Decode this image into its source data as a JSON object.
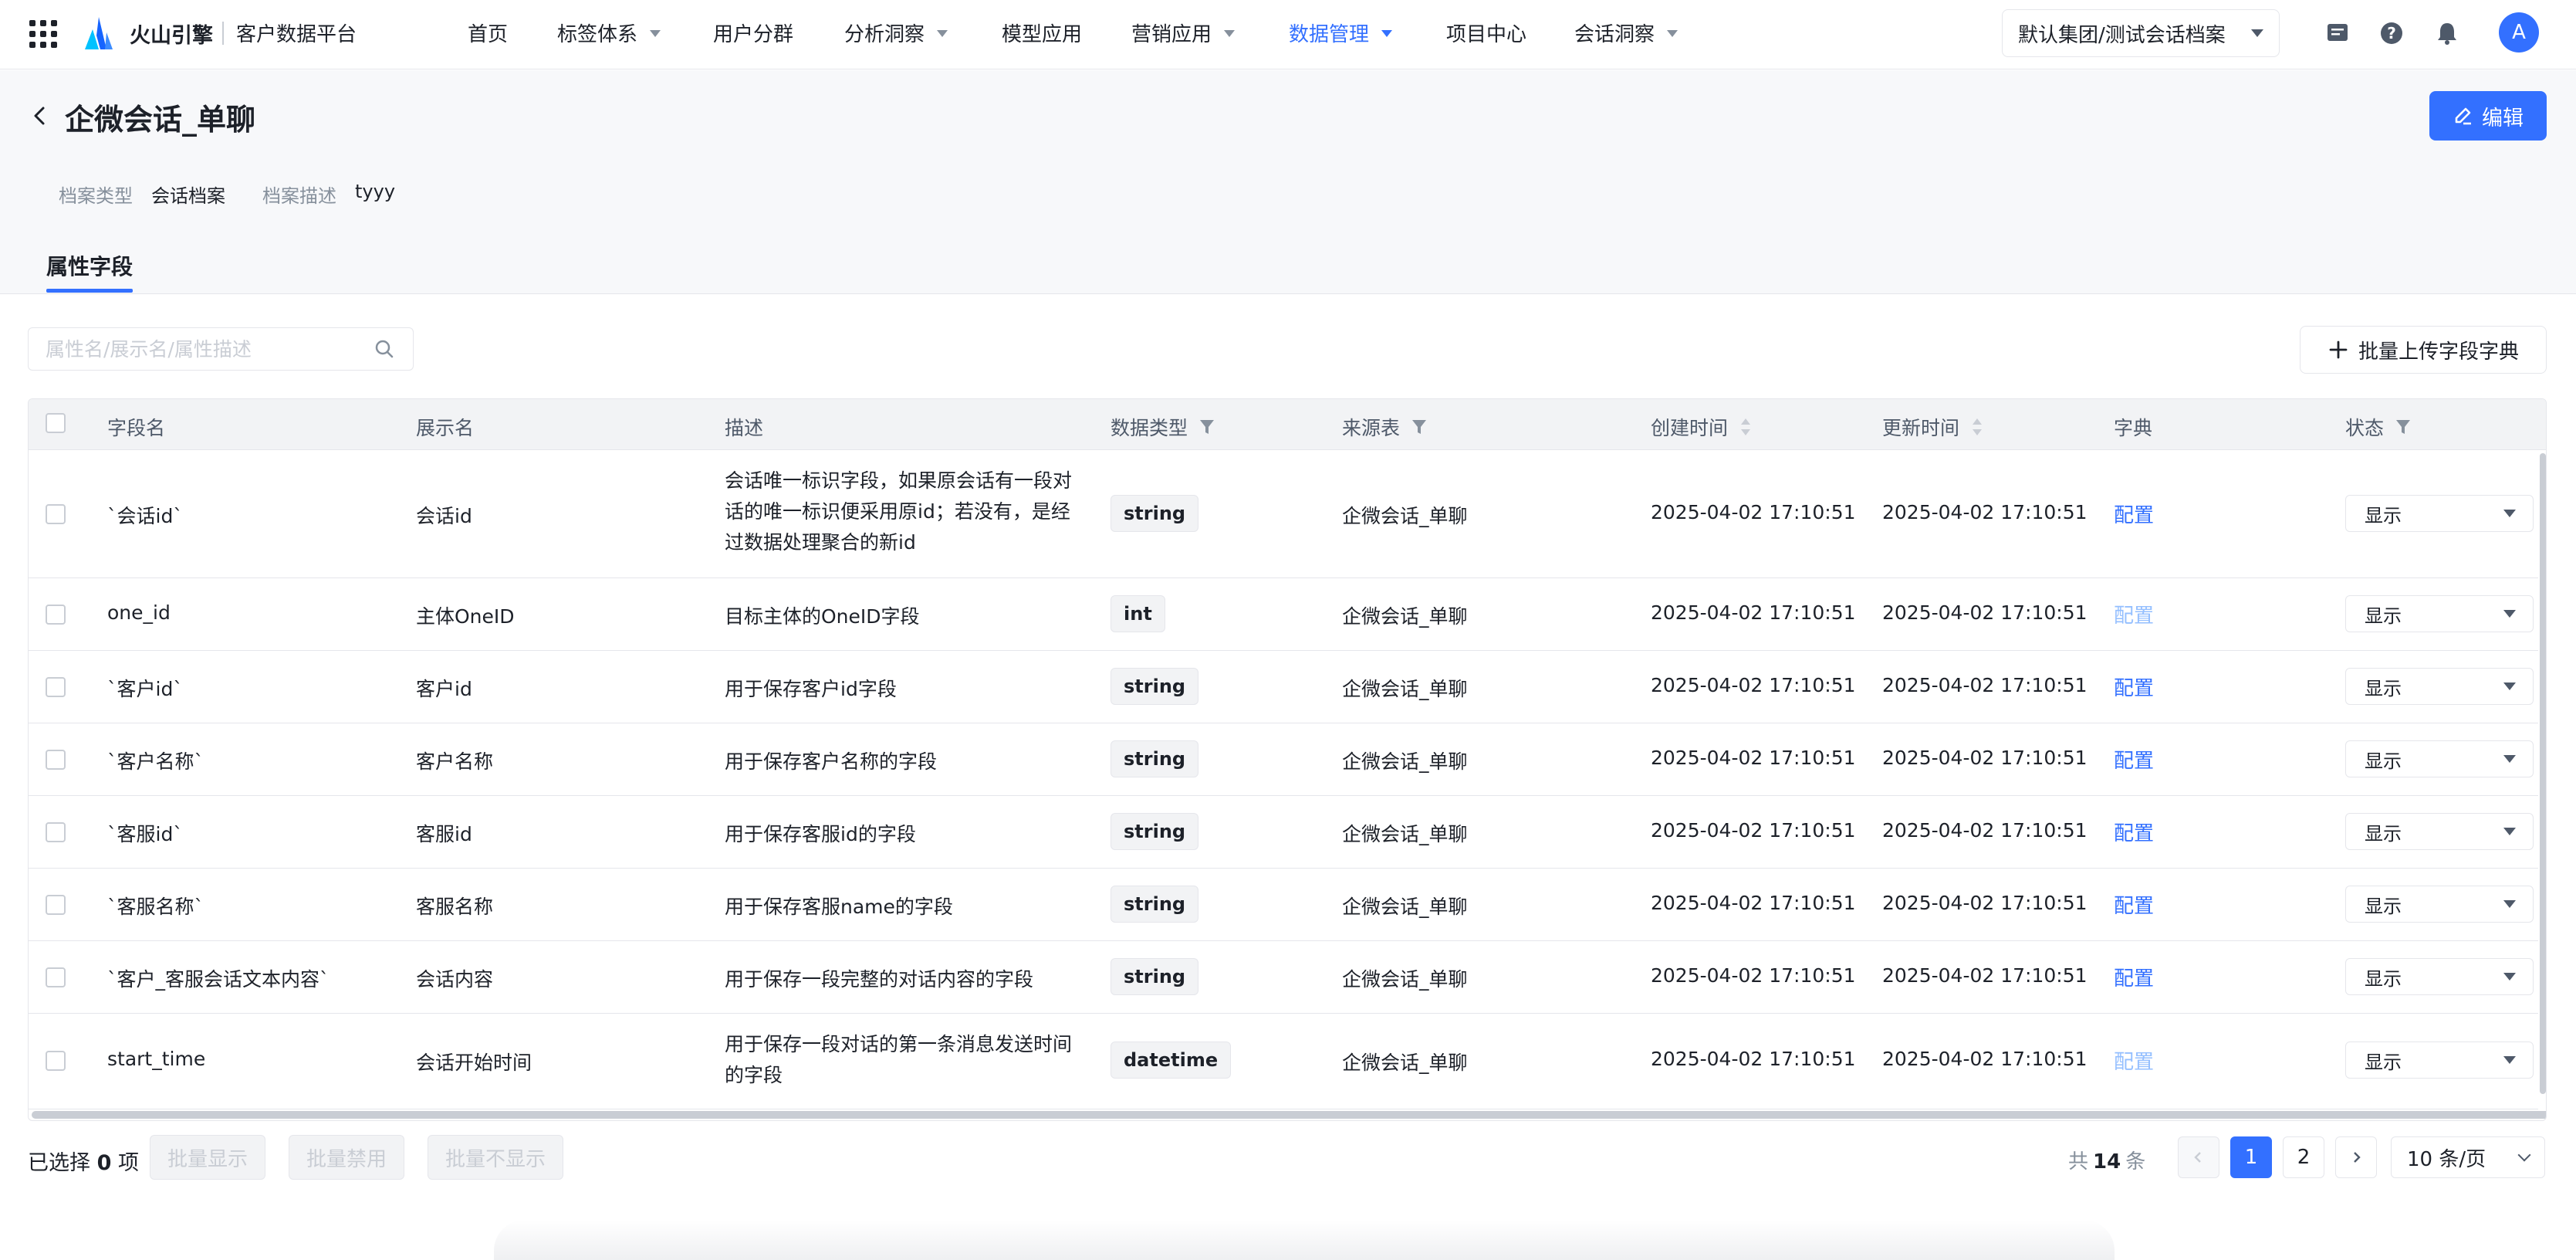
{
  "header": {
    "brand": "火山引擎",
    "platform": "客户数据平台",
    "nav": [
      {
        "label": "首页",
        "dropdown": false,
        "active": false
      },
      {
        "label": "标签体系",
        "dropdown": true,
        "active": false
      },
      {
        "label": "用户分群",
        "dropdown": false,
        "active": false
      },
      {
        "label": "分析洞察",
        "dropdown": true,
        "active": false
      },
      {
        "label": "模型应用",
        "dropdown": false,
        "active": false
      },
      {
        "label": "营销应用",
        "dropdown": true,
        "active": false
      },
      {
        "label": "数据管理",
        "dropdown": true,
        "active": true
      },
      {
        "label": "项目中心",
        "dropdown": false,
        "active": false
      },
      {
        "label": "会话洞察",
        "dropdown": true,
        "active": false
      }
    ],
    "org_selector": "默认集团/测试会话档案",
    "avatar": "A",
    "icons": [
      "message-icon",
      "help-icon",
      "bell-icon"
    ],
    "accent_color": "#3370ff"
  },
  "page": {
    "title": "企微会话_单聊",
    "edit_label": "编辑",
    "meta": [
      {
        "label": "档案类型",
        "value": "会话档案"
      },
      {
        "label": "档案描述",
        "value": "tyyy"
      }
    ],
    "tab": "属性字段"
  },
  "toolbar": {
    "search_placeholder": "属性名/展示名/属性描述",
    "upload_label": "批量上传字段字典"
  },
  "table": {
    "columns": [
      "字段名",
      "展示名",
      "描述",
      "数据类型",
      "来源表",
      "创建时间",
      "更新时间",
      "字典",
      "状态"
    ],
    "rows": [
      {
        "field": "`会话id`",
        "display": "会话id",
        "desc": "会话唯一标识字段，如果原会话有一段对话的唯一标识便采用原id；若没有，是经过数据处理聚合的新id",
        "type": "string",
        "source": "企微会话_单聊",
        "created": "2025-04-02 17:10:51",
        "updated": "2025-04-02 17:10:51",
        "dict": "配置",
        "dict_enabled": true,
        "status": "显示"
      },
      {
        "field": "one_id",
        "display": "主体OneID",
        "desc": "目标主体的OneID字段",
        "type": "int",
        "source": "企微会话_单聊",
        "created": "2025-04-02 17:10:51",
        "updated": "2025-04-02 17:10:51",
        "dict": "配置",
        "dict_enabled": false,
        "status": "显示"
      },
      {
        "field": "`客户id`",
        "display": "客户id",
        "desc": "用于保存客户id字段",
        "type": "string",
        "source": "企微会话_单聊",
        "created": "2025-04-02 17:10:51",
        "updated": "2025-04-02 17:10:51",
        "dict": "配置",
        "dict_enabled": true,
        "status": "显示"
      },
      {
        "field": "`客户名称`",
        "display": "客户名称",
        "desc": "用于保存客户名称的字段",
        "type": "string",
        "source": "企微会话_单聊",
        "created": "2025-04-02 17:10:51",
        "updated": "2025-04-02 17:10:51",
        "dict": "配置",
        "dict_enabled": true,
        "status": "显示"
      },
      {
        "field": "`客服id`",
        "display": "客服id",
        "desc": "用于保存客服id的字段",
        "type": "string",
        "source": "企微会话_单聊",
        "created": "2025-04-02 17:10:51",
        "updated": "2025-04-02 17:10:51",
        "dict": "配置",
        "dict_enabled": true,
        "status": "显示"
      },
      {
        "field": "`客服名称`",
        "display": "客服名称",
        "desc": "用于保存客服name的字段",
        "type": "string",
        "source": "企微会话_单聊",
        "created": "2025-04-02 17:10:51",
        "updated": "2025-04-02 17:10:51",
        "dict": "配置",
        "dict_enabled": true,
        "status": "显示"
      },
      {
        "field": "`客户_客服会话文本内容`",
        "display": "会话内容",
        "desc": "用于保存一段完整的对话内容的字段",
        "type": "string",
        "source": "企微会话_单聊",
        "created": "2025-04-02 17:10:51",
        "updated": "2025-04-02 17:10:51",
        "dict": "配置",
        "dict_enabled": true,
        "status": "显示"
      },
      {
        "field": "start_time",
        "display": "会话开始时间",
        "desc": "用于保存一段对话的第一条消息发送时间的字段",
        "type": "datetime",
        "source": "企微会话_单聊",
        "created": "2025-04-02 17:10:51",
        "updated": "2025-04-02 17:10:51",
        "dict": "配置",
        "dict_enabled": false,
        "status": "显示"
      }
    ]
  },
  "footer": {
    "selected_prefix": "已选择",
    "selected_count": "0",
    "selected_suffix": "项",
    "batch_buttons": [
      "批量显示",
      "批量禁用",
      "批量不显示"
    ],
    "total_prefix": "共",
    "total_count": "14",
    "total_suffix": "条",
    "pages": [
      "1",
      "2"
    ],
    "current_page": "1",
    "page_size": "10 条/页"
  }
}
